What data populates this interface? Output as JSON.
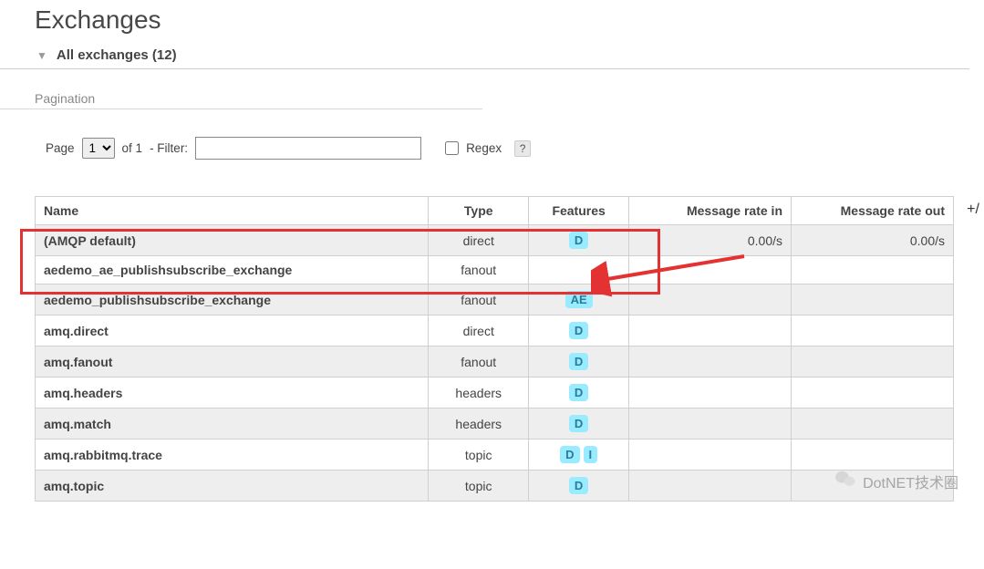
{
  "page": {
    "title": "Exchanges",
    "sub_header": "All exchanges (12)",
    "pagination_label": "Pagination",
    "page_label": "Page",
    "of_text": "of 1",
    "filter_label": "- Filter:",
    "current_page": "1",
    "regex_label": "Regex",
    "help": "?",
    "add": "+/"
  },
  "columns": {
    "name": "Name",
    "type": "Type",
    "features": "Features",
    "rate_in": "Message rate in",
    "rate_out": "Message rate out"
  },
  "rows": [
    {
      "name": "(AMQP default)",
      "type": "direct",
      "features": [
        "D"
      ],
      "rate_in": "0.00/s",
      "rate_out": "0.00/s",
      "stripe": true
    },
    {
      "name": "aedemo_ae_publishsubscribe_exchange",
      "type": "fanout",
      "features": [],
      "rate_in": "",
      "rate_out": "",
      "stripe": false
    },
    {
      "name": "aedemo_publishsubscribe_exchange",
      "type": "fanout",
      "features": [
        "AE"
      ],
      "rate_in": "",
      "rate_out": "",
      "stripe": true
    },
    {
      "name": "amq.direct",
      "type": "direct",
      "features": [
        "D"
      ],
      "rate_in": "",
      "rate_out": "",
      "stripe": false
    },
    {
      "name": "amq.fanout",
      "type": "fanout",
      "features": [
        "D"
      ],
      "rate_in": "",
      "rate_out": "",
      "stripe": true
    },
    {
      "name": "amq.headers",
      "type": "headers",
      "features": [
        "D"
      ],
      "rate_in": "",
      "rate_out": "",
      "stripe": false
    },
    {
      "name": "amq.match",
      "type": "headers",
      "features": [
        "D"
      ],
      "rate_in": "",
      "rate_out": "",
      "stripe": true
    },
    {
      "name": "amq.rabbitmq.trace",
      "type": "topic",
      "features": [
        "D",
        "I"
      ],
      "rate_in": "",
      "rate_out": "",
      "stripe": false
    },
    {
      "name": "amq.topic",
      "type": "topic",
      "features": [
        "D"
      ],
      "rate_in": "",
      "rate_out": "",
      "stripe": true
    }
  ],
  "watermark": {
    "text": "DotNET技术圈"
  }
}
